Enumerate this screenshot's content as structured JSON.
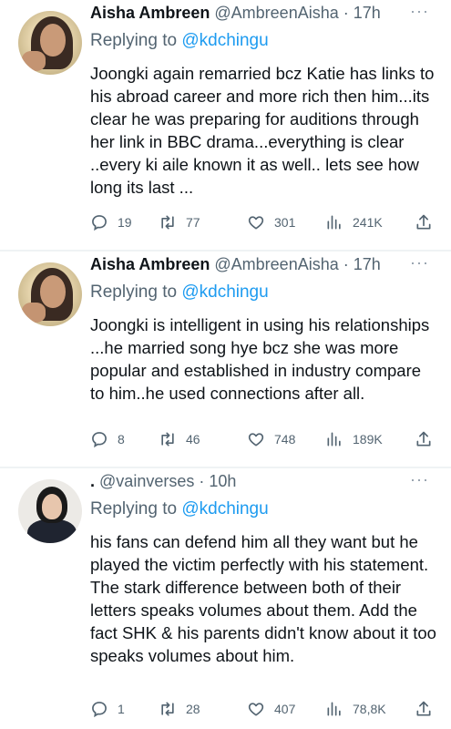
{
  "tweets": [
    {
      "name": "Aisha Ambreen",
      "handle": "@AmbreenAisha",
      "time": "17h",
      "reply_label": "Replying to",
      "reply_to": "@kdchingu",
      "text": "Joongki again remarried bcz Katie has links to his abroad career and more rich then him...its clear he was preparing for auditions through her link in BBC drama...everything is clear ..every ki aile known it as well.. lets see how long its last ...",
      "replies": "19",
      "retweets": "77",
      "likes": "301",
      "views": "241K"
    },
    {
      "name": "Aisha Ambreen",
      "handle": "@AmbreenAisha",
      "time": "17h",
      "reply_label": "Replying to",
      "reply_to": "@kdchingu",
      "text": "Joongki is intelligent in using his relationships ...he married song hye bcz she was more popular and established in industry compare to him..he used connections after all.",
      "replies": "8",
      "retweets": "46",
      "likes": "748",
      "views": "189K"
    },
    {
      "name": ".",
      "handle": "@vainverses",
      "time": "10h",
      "reply_label": "Replying to",
      "reply_to": "@kdchingu",
      "text": "his fans can defend him all they want but he played the victim perfectly with his statement. The stark difference between both of their letters speaks volumes about them. Add the fact SHK & his parents didn't know about it too speaks volumes about him.",
      "replies": "1",
      "retweets": "28",
      "likes": "407",
      "views": "78,8K"
    }
  ],
  "separator": "·",
  "more_glyph": "···",
  "icons": [
    "reply-icon",
    "retweet-icon",
    "like-icon",
    "views-icon",
    "share-icon",
    "more-icon"
  ]
}
